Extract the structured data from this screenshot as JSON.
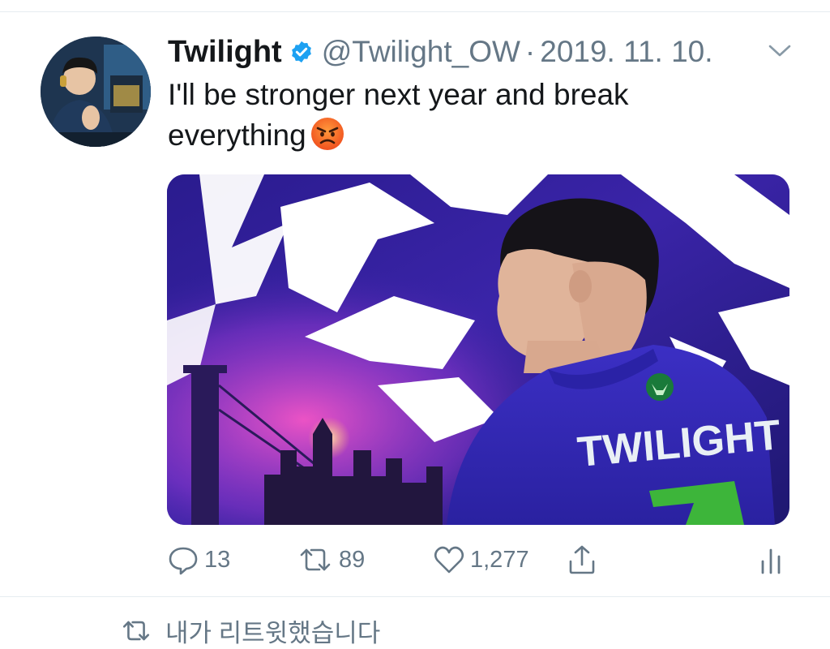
{
  "tweet": {
    "display_name": "Twilight",
    "handle": "@Twilight_OW",
    "separator": "·",
    "date": "2019. 11. 10.",
    "text": "I'll be stronger next year and break everything",
    "emoji": "angry-face"
  },
  "media": {
    "jersey_text": "TWILIGHT",
    "jersey_number": "7"
  },
  "actions": {
    "reply_count": "13",
    "retweet_count": "89",
    "like_count": "1,277"
  },
  "next_item": {
    "retweeted_label": "내가 리트윗했습니다"
  },
  "colors": {
    "verified": "#1da1f2",
    "muted": "#657786",
    "text": "#14171a",
    "media_bg": "#2e1f8c"
  },
  "icons": {
    "verified": "verified-badge-icon",
    "chevron": "chevron-down-icon",
    "reply": "reply-icon",
    "retweet": "retweet-icon",
    "like": "heart-icon",
    "share": "share-icon",
    "analytics": "analytics-icon"
  }
}
